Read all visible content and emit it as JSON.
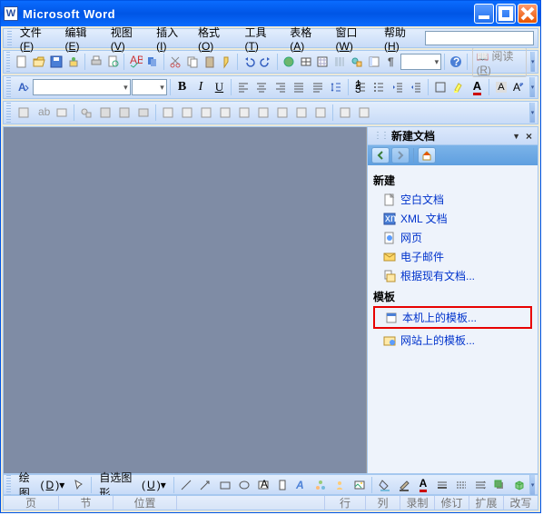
{
  "app": {
    "title": "Microsoft Word"
  },
  "menu": {
    "file": "文件",
    "file_k": "F",
    "edit": "编辑",
    "edit_k": "E",
    "view": "视图",
    "view_k": "V",
    "insert": "插入",
    "insert_k": "I",
    "format": "格式",
    "format_k": "O",
    "tools": "工具",
    "tools_k": "T",
    "table": "表格",
    "table_k": "A",
    "window": "窗口",
    "window_k": "W",
    "help": "帮助",
    "help_k": "H"
  },
  "toolbar1": {
    "zoom": "",
    "read": "阅读",
    "read_k": "R"
  },
  "toolbar2": {
    "bold": "B",
    "italic": "I",
    "underline": "U",
    "font_name": "",
    "font_size": "",
    "color_a": "A",
    "color_a2": "A"
  },
  "drawbar": {
    "draw": "绘图",
    "draw_k": "D",
    "autoshape": "自选图形",
    "autoshape_k": "U",
    "text_a": "A"
  },
  "taskpane": {
    "title": "新建文档",
    "section_new": "新建",
    "items_new": [
      "空白文档",
      "XML 文档",
      "网页",
      "电子邮件",
      "根据现有文档..."
    ],
    "section_tpl": "模板",
    "items_tpl": [
      "本机上的模板...",
      "网站上的模板..."
    ]
  },
  "status": {
    "page": "页",
    "section": "节",
    "pos": "位置",
    "line": "行",
    "col": "列",
    "rec": "录制",
    "rev": "修订",
    "ext": "扩展",
    "ovr": "改写"
  },
  "icons": {
    "blank_doc": "📄",
    "xml_doc": "🗎",
    "web": "🌐",
    "email": "✉",
    "existing": "📁",
    "local_tpl": "🗎",
    "web_tpl": "🖼"
  },
  "colors": {
    "link": "#0033cc",
    "accent": "#0055e5",
    "highlight": "#e80000"
  }
}
